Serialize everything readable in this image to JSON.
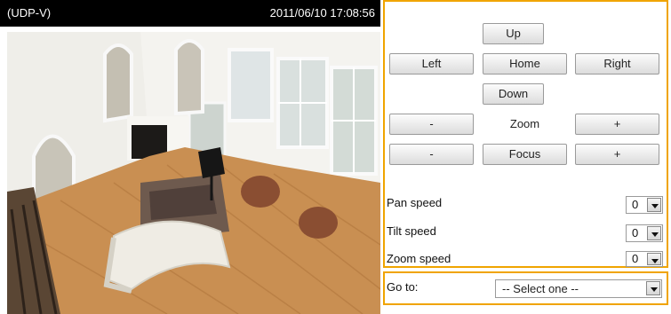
{
  "video": {
    "stream_label": "(UDP-V)",
    "timestamp": "2011/06/10  17:08:56"
  },
  "ptz": {
    "up_label": "Up",
    "left_label": "Left",
    "home_label": "Home",
    "right_label": "Right",
    "down_label": "Down",
    "zoom_out_label": "-",
    "zoom_label": "Zoom",
    "zoom_in_label": "+",
    "focus_near_label": "-",
    "focus_label": "Focus",
    "focus_far_label": "+"
  },
  "speeds": {
    "pan": {
      "label": "Pan speed",
      "value": "0"
    },
    "tilt": {
      "label": "Tilt speed",
      "value": "0"
    },
    "zoom": {
      "label": "Zoom speed",
      "value": "0"
    }
  },
  "goto": {
    "label": "Go to:",
    "selected": "-- Select one --"
  },
  "colors": {
    "panel_border": "#f0a400",
    "header_bg": "#000000"
  }
}
